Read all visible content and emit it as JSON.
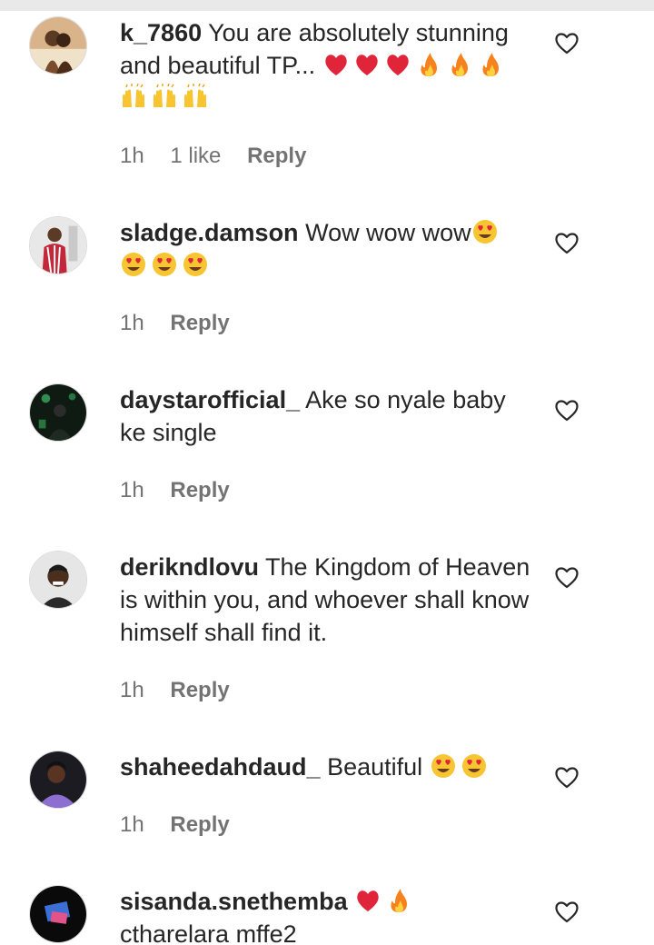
{
  "comments": [
    {
      "username": "k_7860",
      "text": "You are absolutely stunning and beautiful TP...",
      "emojis": [
        "red-heart",
        "red-heart",
        "red-heart",
        "fire",
        "fire",
        "fire",
        "raising-hands",
        "raising-hands",
        "raising-hands"
      ],
      "time": "1h",
      "likes": "1 like",
      "reply": "Reply"
    },
    {
      "username": "sladge.damson",
      "text": "Wow wow wow",
      "emojis": [
        "heart-eyes",
        "heart-eyes",
        "heart-eyes",
        "heart-eyes"
      ],
      "time": "1h",
      "reply": "Reply"
    },
    {
      "username": "daystarofficial_",
      "text": "Ake so nyale baby ke single",
      "emojis": [],
      "time": "1h",
      "reply": "Reply"
    },
    {
      "username": "derikndlovu",
      "text": "The Kingdom of Heaven is within you, and whoever shall know himself shall find it.",
      "emojis": [],
      "time": "1h",
      "reply": "Reply"
    },
    {
      "username": "shaheedahdaud_",
      "text": "Beautiful",
      "emojis": [
        "heart-eyes",
        "heart-eyes"
      ],
      "time": "1h",
      "reply": "Reply"
    },
    {
      "username": "sisanda.snethemba",
      "text": "",
      "emojis": [
        "red-heart",
        "fire"
      ],
      "text2": "ctharelara mffe2",
      "time": "",
      "reply": ""
    }
  ],
  "colors": {
    "text": "#262626",
    "meta": "#737373",
    "heart_red": "#e0243a",
    "fire_orange": "#f5821f",
    "emoji_yellow": "#f7c531"
  },
  "icons": {
    "like": "heart-outline-icon"
  }
}
